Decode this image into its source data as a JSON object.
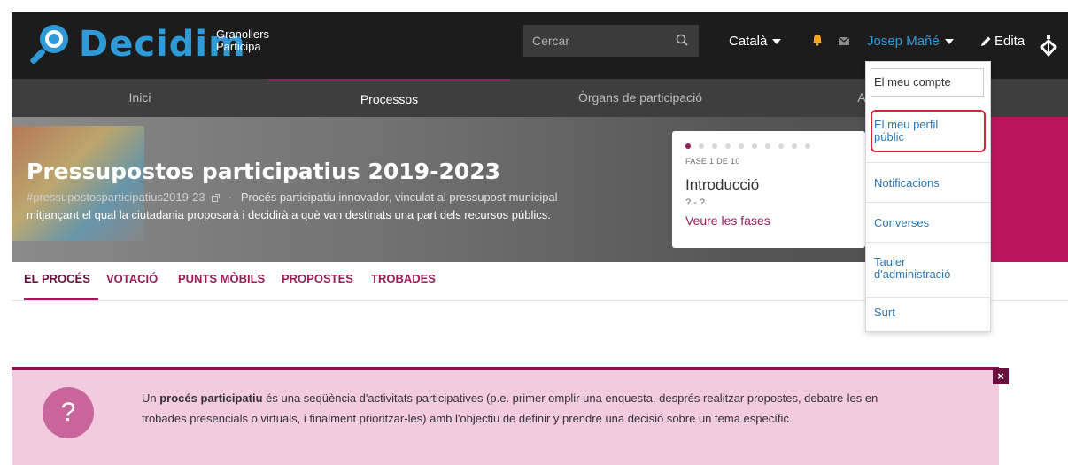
{
  "header": {
    "logo_text": "Decidim",
    "org_line1": "Granollers",
    "org_line2": "Participa",
    "search_placeholder": "Cercar",
    "language": "Català",
    "user_name": "Josep Mañé",
    "edit_label": "Edita"
  },
  "nav": {
    "items": [
      {
        "label": "Inici"
      },
      {
        "label": "Processos"
      },
      {
        "label": "Òrgans de participació"
      },
      {
        "label": "A"
      }
    ]
  },
  "hero": {
    "title": "Pressupostos participatius 2019-2023",
    "hashtag": "#pressupostosparticipatius2019-23",
    "separator": "·",
    "desc_line1": "Procés participatiu innovador, vinculat al pressupost municipal",
    "desc_line2": "mitjançant el qual la ciutadania proposarà i decidirà a què van destinats una part dels recursos públics."
  },
  "phase": {
    "label": "FASE 1 DE 10",
    "name": "Introducció",
    "dates": "? - ?",
    "link": "Veure les fases",
    "total_phases": 10,
    "current_phase": 1
  },
  "process_tabs": [
    {
      "label": "EL PROCÉS"
    },
    {
      "label": "VOTACIÓ"
    },
    {
      "label": "PUNTS MÒBILS"
    },
    {
      "label": "PROPOSTES"
    },
    {
      "label": "TROBADES"
    }
  ],
  "callout": {
    "icon": "?",
    "close": "×",
    "text_pre": "Un ",
    "text_bold": "procés participatiu",
    "text_line1": " és una seqüència d'activitats participatives (p.e. primer omplir una enquesta, després realitzar propostes, debatre-les en",
    "text_line2": "trobades presencials o virtuals, i finalment prioritzar-les) amb l'objectiu de definir y prendre una decisió sobre un tema específic."
  },
  "dropdown": {
    "items": [
      {
        "label": "El meu compte"
      },
      {
        "label_line1": "El meu perfil",
        "label_line2": "públic"
      },
      {
        "label": "Notificacions"
      },
      {
        "label": "Converses"
      },
      {
        "label_line1": "Tauler",
        "label_line2": "d'administració"
      },
      {
        "label": "Surt"
      }
    ]
  },
  "colors": {
    "brand_blue": "#2e9ad8",
    "brand_magenta": "#9c1c5b",
    "highlight_red": "#cc2a3a",
    "callout_bg": "#f2cbe0"
  }
}
